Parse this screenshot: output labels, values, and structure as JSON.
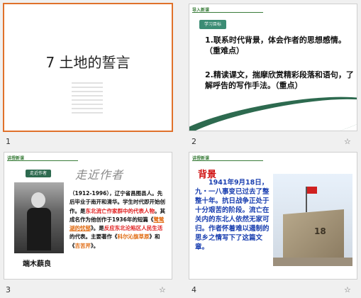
{
  "slides": [
    {
      "number": "1",
      "title": "7 土地的誓言"
    },
    {
      "number": "2",
      "section_tag": "导入新课",
      "goal_label": "学习目标",
      "point1": "1.联系时代背景，体会作者的思想感情。（重难点）",
      "point2": "2.精读课文，揣摩欣赏精彩段落和语句，了解呼告的写作手法。（重点）"
    },
    {
      "number": "3",
      "section_tag": "讲授新课",
      "author_label": "走近作者",
      "art_word": "走近作者",
      "caption": "端木蕻良",
      "bio_a": "（1912-1996），辽宁省昌图县人。先后毕业于南开和清华。学生时代即开始创作。是",
      "bio_red1": "东北流亡作家群中的代表人物",
      "bio_b": "。其成名作为他创作于1936年的短篇《",
      "bio_orange1": "鹭鸶湖的忧郁",
      "bio_c": "》。是",
      "bio_red2": "反应东北沦陷区人民生活",
      "bio_d": "的代表。主要著作《",
      "bio_orange2": "科尔沁旗草原",
      "bio_e": "》和《",
      "bio_orange3": "吉苦芹",
      "bio_f": "》。"
    },
    {
      "number": "4",
      "section_tag": "讲授新课",
      "heading": "背景",
      "body": "1941年9月18日，九・一八事变已过去了整整十年。抗日战争正处于十分艰苦的阶段。流亡在关内的东北人依然无家可归。作者怀着难以遏制的思乡之情写下了这篇文章。",
      "monument_number": "18"
    }
  ],
  "star_icon": "☆"
}
